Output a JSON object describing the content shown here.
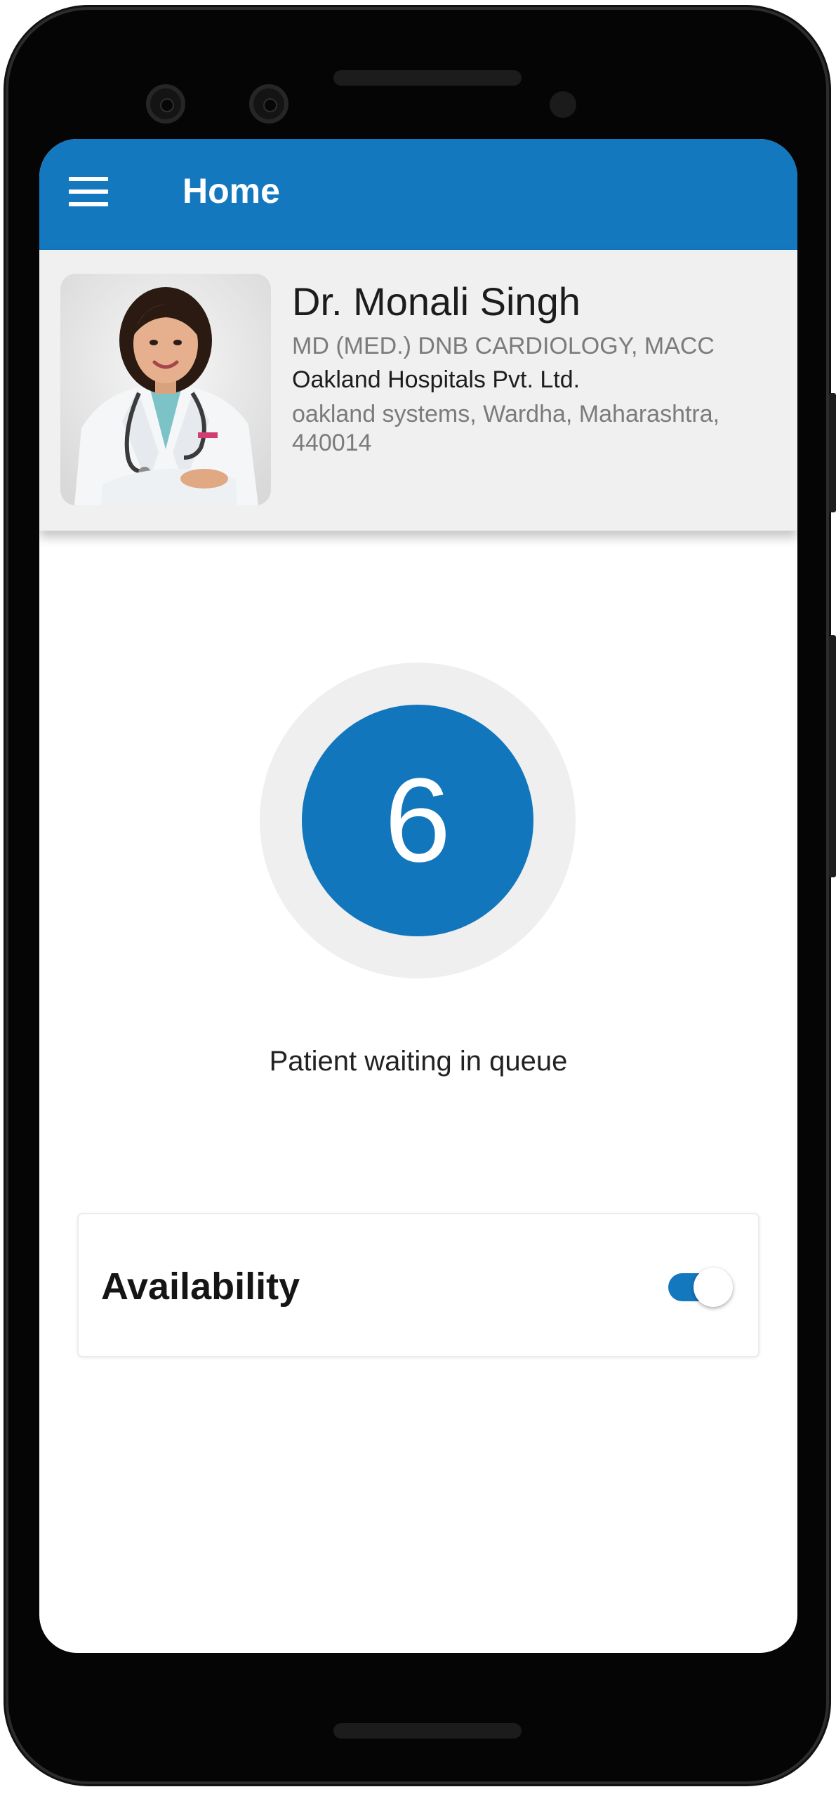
{
  "app_bar": {
    "title": "Home",
    "menu_icon": "hamburger-menu-icon",
    "color": "#1478bf"
  },
  "profile": {
    "name": "Dr. Monali Singh",
    "qualification": "MD (MED.) DNB CARDIOLOGY, MACC",
    "hospital": "Oakland Hospitals Pvt. Ltd.",
    "address": "oakland systems, Wardha, Maharashtra, 440014"
  },
  "queue": {
    "count": "6",
    "label": "Patient waiting in queue",
    "color": "#1276bd"
  },
  "availability": {
    "label": "Availability",
    "enabled": true,
    "toggle_color": "#1478bf"
  }
}
